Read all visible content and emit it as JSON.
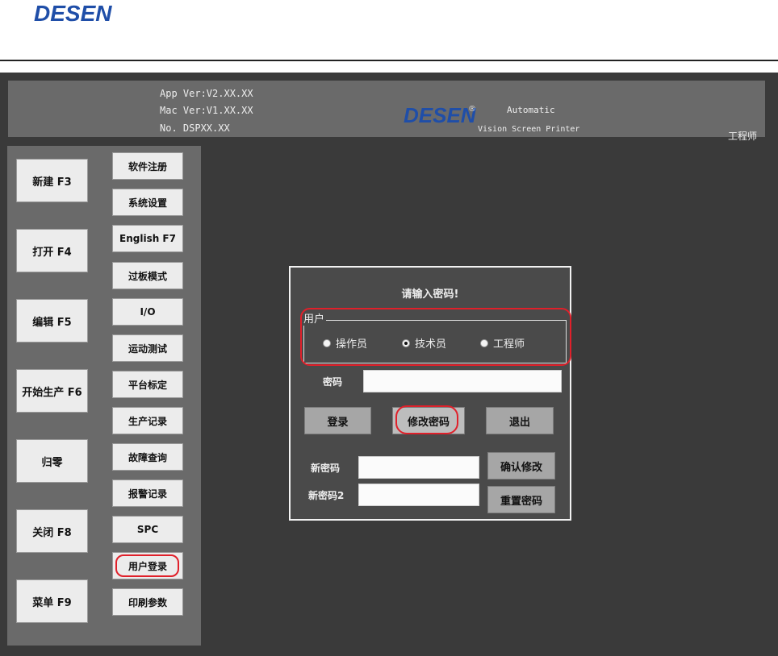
{
  "doc": {
    "logo_text": "DESEN"
  },
  "header": {
    "app_ver": "App Ver:V2.XX.XX",
    "mac_ver": "Mac Ver:V1.XX.XX",
    "model_no": "No. DSPXX.XX",
    "logo_text": "DESEN",
    "registered_mark": "®",
    "automatic": "Automatic",
    "vision": "Vision Screen Printer",
    "current_user": "工程师"
  },
  "sidebar": {
    "main_buttons": [
      "新建 F3",
      "打开 F4",
      "编辑 F5",
      "开始生产 F6",
      "归零",
      "关闭 F8",
      "菜单 F9"
    ],
    "function_buttons": [
      "软件注册",
      "系统设置",
      "English F7",
      "过板模式",
      "I/O",
      "运动测试",
      "平台标定",
      "生产记录",
      "故障查询",
      "报警记录",
      "SPC",
      "用户登录",
      "印刷参数"
    ]
  },
  "dialog": {
    "title": "请输入密码!",
    "user_group_label": "用户",
    "roles": [
      {
        "label": "操作员",
        "selected": false
      },
      {
        "label": "技术员",
        "selected": true
      },
      {
        "label": "工程师",
        "selected": false
      }
    ],
    "password_label": "密码",
    "password_value": "",
    "login_button": "登录",
    "change_password_button": "修改密码",
    "exit_button": "退出",
    "new_password_label": "新密码",
    "new_password2_label": "新密码2",
    "confirm_change_button": "确认修改",
    "reset_password_button": "重置密码"
  },
  "colors": {
    "highlight": "#e0202a",
    "logo_blue": "#1f4ea8"
  }
}
